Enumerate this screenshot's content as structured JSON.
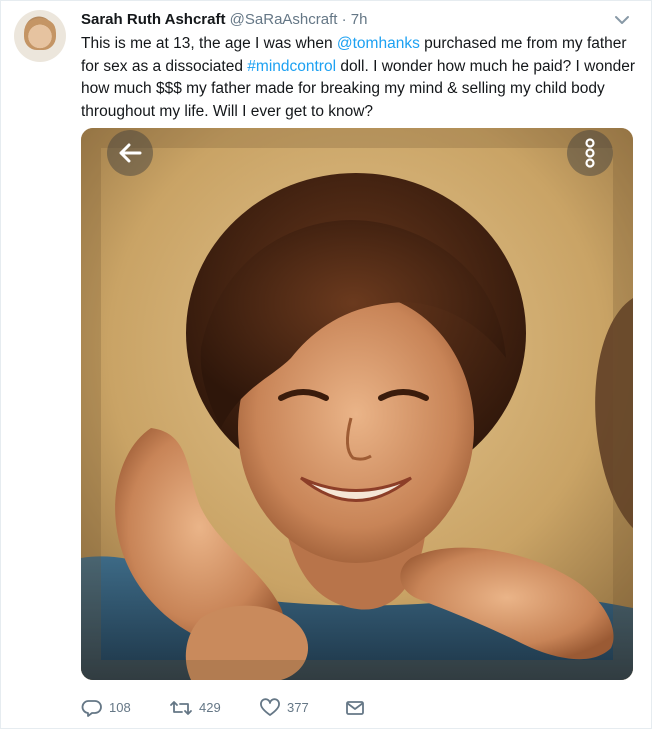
{
  "tweet": {
    "author": {
      "name": "Sarah Ruth Ashcraft",
      "handle": "@SaRaAshcraft",
      "separator": "·",
      "time": "7h"
    },
    "text_parts": [
      {
        "text": "This is me at 13, the age I was when ",
        "link": false
      },
      {
        "text": "@tomhanks",
        "link": true
      },
      {
        "text": " purchased me from my father for sex as a dissociated ",
        "link": false
      },
      {
        "text": "#mindcontrol",
        "link": true
      },
      {
        "text": " doll. I wonder how much he paid? I wonder how much $$$ my father made for breaking my mind & selling my child body throughout my life. Will I ever get to know?",
        "link": false
      }
    ],
    "link_color": "#1da1f2",
    "media": {
      "back_icon": "arrow-left-icon",
      "more_icon": "more-vertical-icon"
    },
    "actions": {
      "reply": {
        "icon": "reply-icon",
        "count": "108"
      },
      "retweet": {
        "icon": "retweet-icon",
        "count": "429"
      },
      "like": {
        "icon": "heart-icon",
        "count": "377"
      },
      "dm": {
        "icon": "envelope-icon"
      }
    },
    "menu_icon": "chevron-down-icon"
  }
}
